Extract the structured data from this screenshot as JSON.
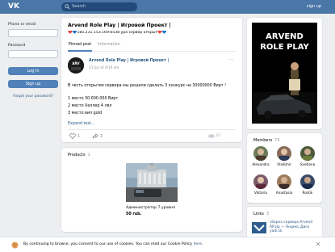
{
  "header": {
    "logo": "VK",
    "search_placeholder": "Search",
    "signup": "sign up"
  },
  "login": {
    "phone_label": "Phone or email",
    "password_label": "Password",
    "login_button": "Log in",
    "signup_button": "Sign up",
    "forgot_link": "Forgot your password?"
  },
  "page": {
    "title": "Arvend Role Play | Игровой Проект |",
    "status": "❤️💙185.231.153.169:6538 ура сервер открыт❤️💙",
    "tabs": [
      "Pinned post",
      "Information"
    ]
  },
  "post": {
    "author": "Arvend Role Play | Игровой Проект |",
    "date": "23 Jun at 8:16 am",
    "more": "···",
    "lines": [
      "В честь открытия сервера мы решили сделать 3 конкурс на 30000000 Вирт !",
      "1 место 30.000.000 Вирт",
      "2 место Хеллер 4 лвл",
      "3 место вип gold"
    ],
    "expand": "Expand text...",
    "likes": "1",
    "reposts": "1",
    "views": "67"
  },
  "products": {
    "title": "Products",
    "count": "1",
    "item_name": "Администратор 7 уровня",
    "item_price": "50 rub."
  },
  "side": {
    "image_line1": "ARVEND",
    "image_line2": "ROLE PLAY"
  },
  "members": {
    "title": "Members",
    "count": "79",
    "list": [
      {
        "name": "Alexandra",
        "color": "#6b7a5a"
      },
      {
        "name": "Vladimir",
        "color": "#8a6b5a"
      },
      {
        "name": "Svetlana",
        "color": "#4a5a3a"
      },
      {
        "name": "Viktoria",
        "color": "#7a5a6a"
      },
      {
        "name": "Anastasia",
        "color": "#9a7a5a"
      },
      {
        "name": "Rostik",
        "color": "#3a4a6a"
      }
    ]
  },
  "links": {
    "title": "Links",
    "count": "3",
    "item": "сборка сервера Arvend RP.zip — Яндекс.Диск yadi.sk"
  },
  "cookie": {
    "text": "By continuing to browse, you consent to our use of cookies. You can read our Cookie Policy ",
    "link": "here",
    "close": "✕"
  },
  "colors": {
    "header_bg": "#4a76a8",
    "button_bg": "#5181b8",
    "link": "#2a5885",
    "heart": "#e64646"
  }
}
